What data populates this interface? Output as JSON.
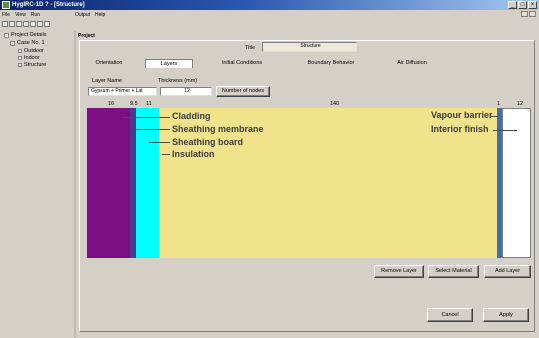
{
  "window": {
    "title": "HygIRC-1D ? - [Structure]"
  },
  "menu": {
    "items": [
      "File",
      "View",
      "Run"
    ],
    "items_right": [
      "Output",
      "Help"
    ]
  },
  "tree": {
    "root": "Project Details",
    "case": "Case No. 1",
    "children": [
      "Outdoor",
      "Indoor",
      "Structure"
    ]
  },
  "panel": {
    "header": "Project",
    "title_label": "Title",
    "title_value": "Structure",
    "tabs": [
      "Orientation",
      "Layers",
      "Initial Conditions",
      "Boundary Behavior",
      "Air Diffusion"
    ],
    "active_tab": "Layers",
    "layer_name_label": "Layer Name",
    "layer_name_value": "Gypsum + Primer + Lat",
    "thickness_label": "Thickness (mm)",
    "thickness_value": "12",
    "nodes_button": "Number of nodes"
  },
  "wall": {
    "thickness_labels": [
      "16",
      "9.5",
      "11",
      "140",
      "1",
      "12"
    ],
    "layers": [
      {
        "name": "Cladding",
        "color": "#7b0e82"
      },
      {
        "name": "Sheathing membrane",
        "color": "#4a3a8a"
      },
      {
        "name": "Sheathing board",
        "color": "#00ffff"
      },
      {
        "name": "Insulation",
        "color": "#f0e38c"
      },
      {
        "name": "Vapour barrier",
        "color": "#3a6eb5"
      },
      {
        "name": "Interior finish",
        "color": "#ffffff"
      }
    ]
  },
  "annotations": {
    "cladding": "Cladding",
    "sheathing_membrane": "Sheathing membrane",
    "sheathing_board": "Sheathing board",
    "insulation": "Insulation",
    "vapour_barrier": "Vapour barrier",
    "interior_finish": "Interior finish"
  },
  "buttons": {
    "remove_layer": "Remove Layer",
    "select_material": "Select Material",
    "add_layer": "Add Layer",
    "cancel": "Cancel",
    "apply": "Apply"
  }
}
